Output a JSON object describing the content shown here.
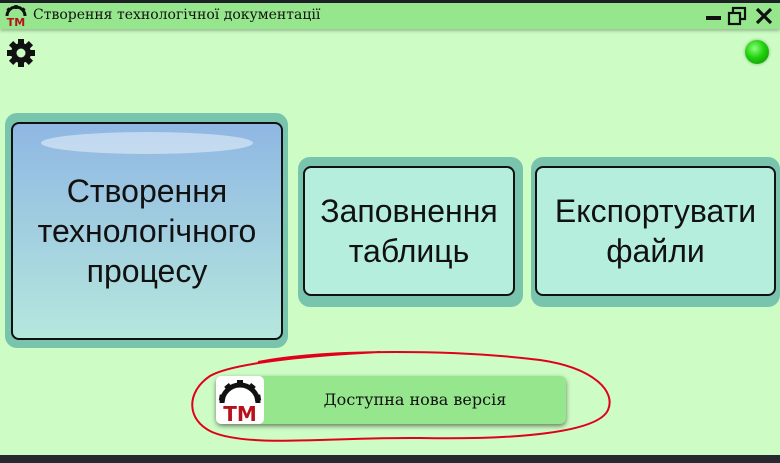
{
  "window": {
    "title": "Створення технологічної документації",
    "logo_text": "TM"
  },
  "header": {
    "settings_icon": "gear-icon",
    "status_icon": "green-status-led",
    "status_color": "#22d80f"
  },
  "tiles": [
    {
      "lines": [
        "Створення",
        "технологічного",
        "процесу"
      ]
    },
    {
      "lines": [
        "Заповнення",
        "таблиць"
      ]
    },
    {
      "lines": [
        "Експортувати",
        "файли"
      ]
    }
  ],
  "notification": {
    "text": "Доступна нова версія",
    "logo_text": "TM"
  },
  "colors": {
    "background": "#cdfcc4",
    "title_bar": "#95e68c",
    "tile": "#b5eedd",
    "tile_shadow": "#79c4ad",
    "annotation": "#e0001b",
    "logo_red": "#b5121b"
  }
}
